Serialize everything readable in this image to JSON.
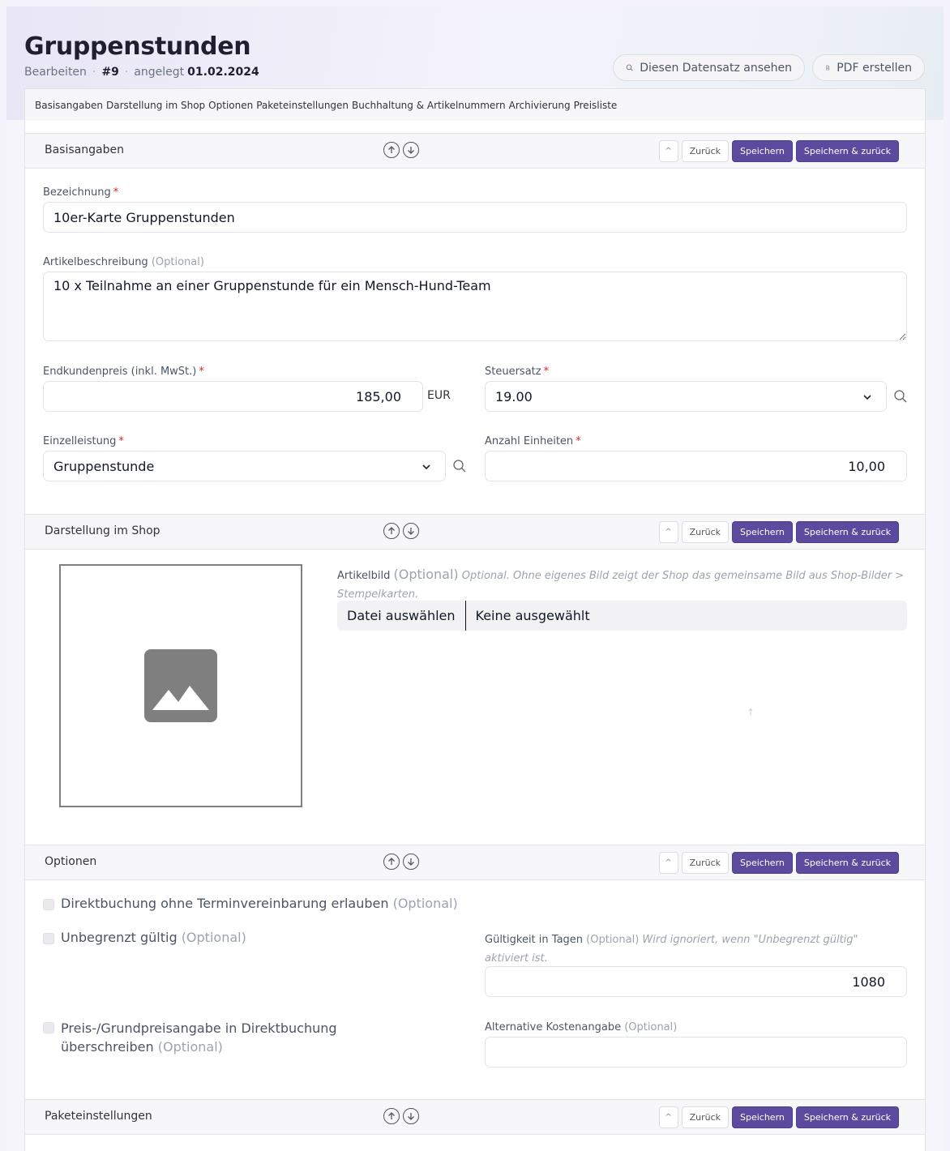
{
  "header": {
    "title": "Gruppenstunden",
    "mode": "Bearbeiten",
    "record_id": "#9",
    "created_label": "angelegt",
    "created_date": "01.02.2024",
    "view_button": "Diesen Datensatz ansehen",
    "pdf_button": "PDF erstellen"
  },
  "tabs": [
    "Basisangaben",
    "Darstellung im Shop",
    "Optionen",
    "Paketeinstellungen",
    "Buchhaltung & Artikelnummern",
    "Archivierung",
    "Preisliste"
  ],
  "section_buttons": {
    "up": "^",
    "back": "Zurück",
    "save": "Speichern",
    "save_back": "Speichern & zurück"
  },
  "sections": {
    "basis": "Basisangaben",
    "shop": "Darstellung im Shop",
    "options": "Optionen",
    "package": "Paketeinstellungen"
  },
  "fields": {
    "name_label": "Bezeichnung",
    "name_value": "10er-Karte Gruppenstunden",
    "desc_label": "Artikelbeschreibung",
    "desc_value": "10 x Teilnahme an einer Gruppenstunde für ein Mensch-Hund-Team",
    "price_label": "Endkundenpreis (inkl. MwSt.)",
    "price_value": "185,00",
    "price_unit": "EUR",
    "tax_label": "Steuersatz",
    "tax_value": "19.00",
    "service_label": "Einzelleistung",
    "service_value": "Gruppenstunde",
    "units_label": "Anzahl Einheiten",
    "units_value": "10,00",
    "image_label": "Artikelbild",
    "image_hint": "Optional. Ohne eigenes Bild zeigt der Shop das gemeinsame Bild aus Shop-Bilder > Stempelkarten.",
    "file_pick": "Datei auswählen",
    "file_none": "Keine ausgewählt",
    "direct_booking": "Direktbuchung ohne Terminvereinbarung erlauben",
    "unlimited": "Unbegrenzt gültig",
    "validity_label": "Gültigkeit in Tagen",
    "validity_hint": "Wird ignoriert, wenn \"Unbegrenzt gültig\" aktiviert ist.",
    "validity_value": "1080",
    "override_price": "Preis-/Grundpreisangabe in Direktbuchung überschreiben",
    "alt_cost_label": "Alternative Kostenangabe",
    "optional": "(Optional)",
    "required_mark": "*"
  },
  "colors": {
    "primary": "#5b4a9e",
    "required": "#dc2626"
  }
}
